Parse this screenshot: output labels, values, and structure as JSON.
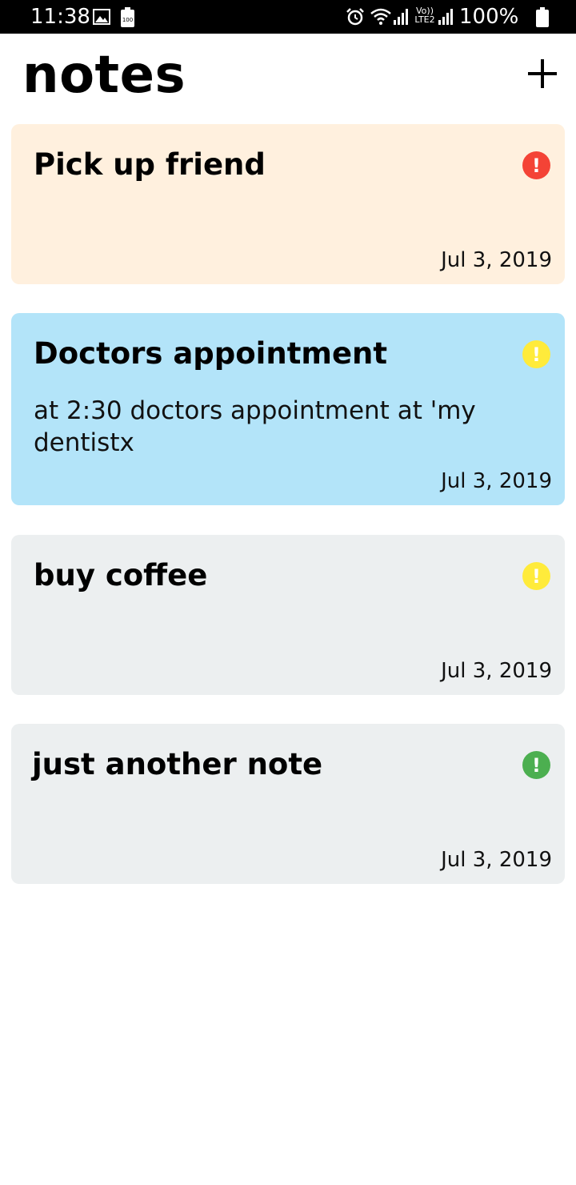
{
  "status_bar": {
    "time": "11:38",
    "battery_small_label": "100",
    "volte_top": "Vo))",
    "volte_bottom": "LTE2",
    "battery_percent": "100%"
  },
  "header": {
    "title": "notes",
    "add_icon": "plus-icon"
  },
  "colors": {
    "status_bar": "#000000",
    "card_orange": "#FFF0DE",
    "card_blue": "#B3E4F9",
    "card_gray": "#ECEFF0",
    "priority_red": "#F44336",
    "priority_yellow": "#FFEB3B",
    "priority_green": "#4CAF50"
  },
  "notes": [
    {
      "title": "Pick up friend",
      "body": "",
      "date": "Jul 3, 2019",
      "background": "#FFF0DE",
      "priority_color": "#F44336",
      "priority_icon": "exclamation-circle-icon"
    },
    {
      "title": "Doctors appointment",
      "body": "at 2:30 doctors appointment at 'my dentistx",
      "date": "Jul 3, 2019",
      "background": "#B3E4F9",
      "priority_color": "#FFEB3B",
      "priority_icon": "exclamation-circle-icon"
    },
    {
      "title": "buy coffee",
      "body": "",
      "date": "Jul 3, 2019",
      "background": "#ECEFF0",
      "priority_color": "#FFEB3B",
      "priority_icon": "exclamation-circle-icon"
    },
    {
      "title": "just another note",
      "body": "",
      "date": "Jul 3, 2019",
      "background": "#ECEFF0",
      "priority_color": "#4CAF50",
      "priority_icon": "exclamation-circle-icon"
    }
  ]
}
